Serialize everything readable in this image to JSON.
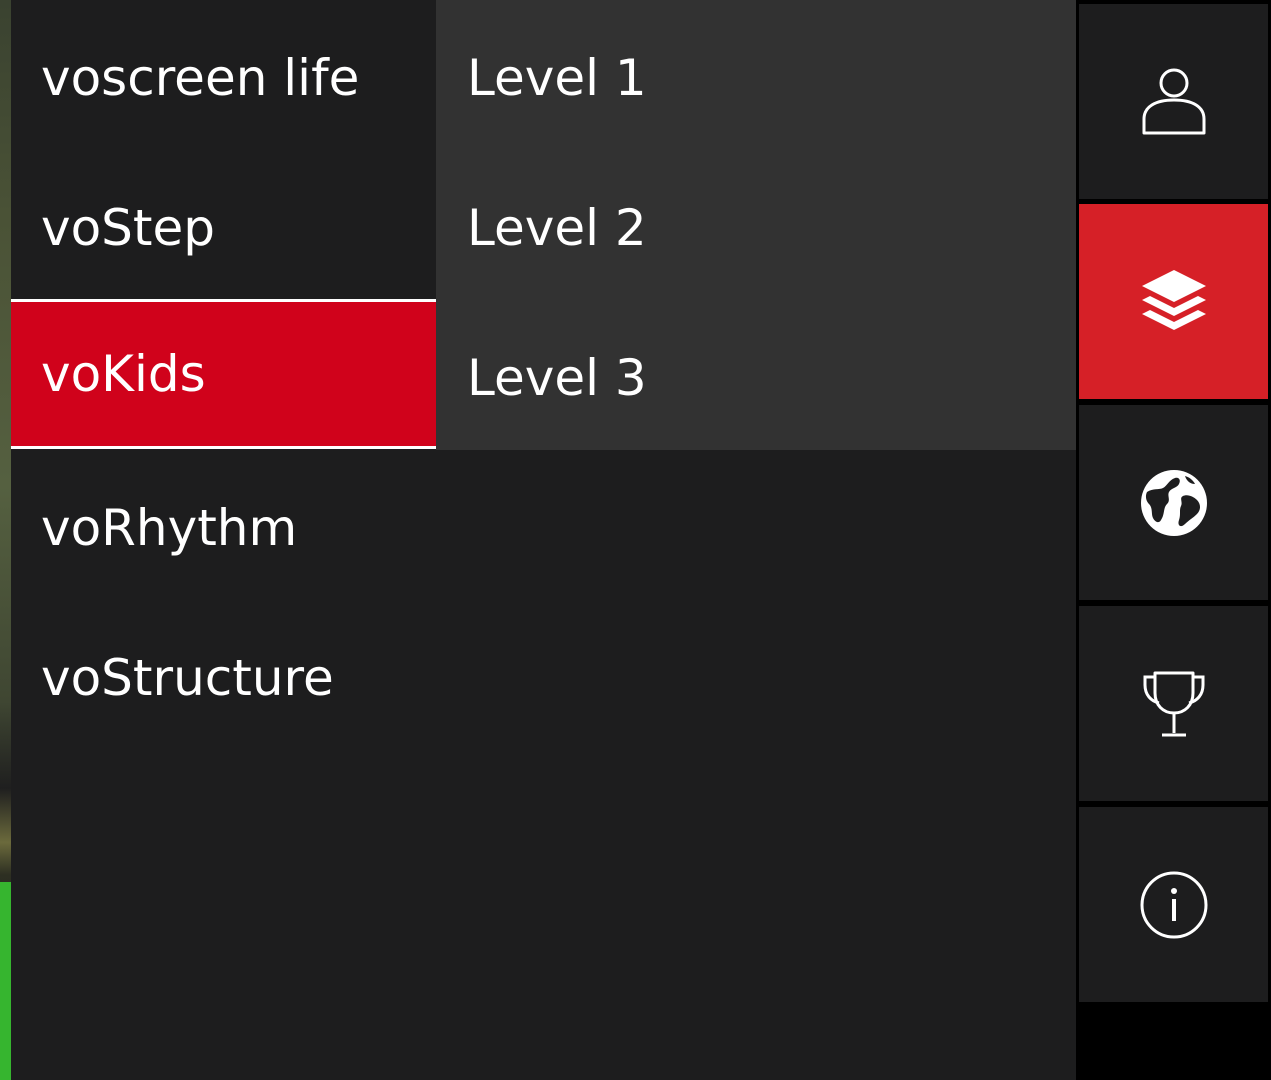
{
  "menu": {
    "items": [
      {
        "label": "voscreen life",
        "active": false
      },
      {
        "label": "voStep",
        "active": false
      },
      {
        "label": "voKids",
        "active": true
      },
      {
        "label": "voRhythm",
        "active": false
      },
      {
        "label": "voStructure",
        "active": false
      }
    ]
  },
  "submenu": {
    "items": [
      {
        "label": "Level 1"
      },
      {
        "label": "Level 2"
      },
      {
        "label": "Level 3"
      }
    ]
  },
  "rail": {
    "buttons": [
      {
        "icon": "user-icon",
        "active": false
      },
      {
        "icon": "layers-icon",
        "active": true
      },
      {
        "icon": "globe-icon",
        "active": false
      },
      {
        "icon": "trophy-icon",
        "active": false
      },
      {
        "icon": "info-icon",
        "active": false
      }
    ]
  },
  "colors": {
    "accent_red": "#d0021b",
    "rail_active_red": "#d62027",
    "panel_dark": "#1d1d1e",
    "panel_mid": "#323232"
  }
}
